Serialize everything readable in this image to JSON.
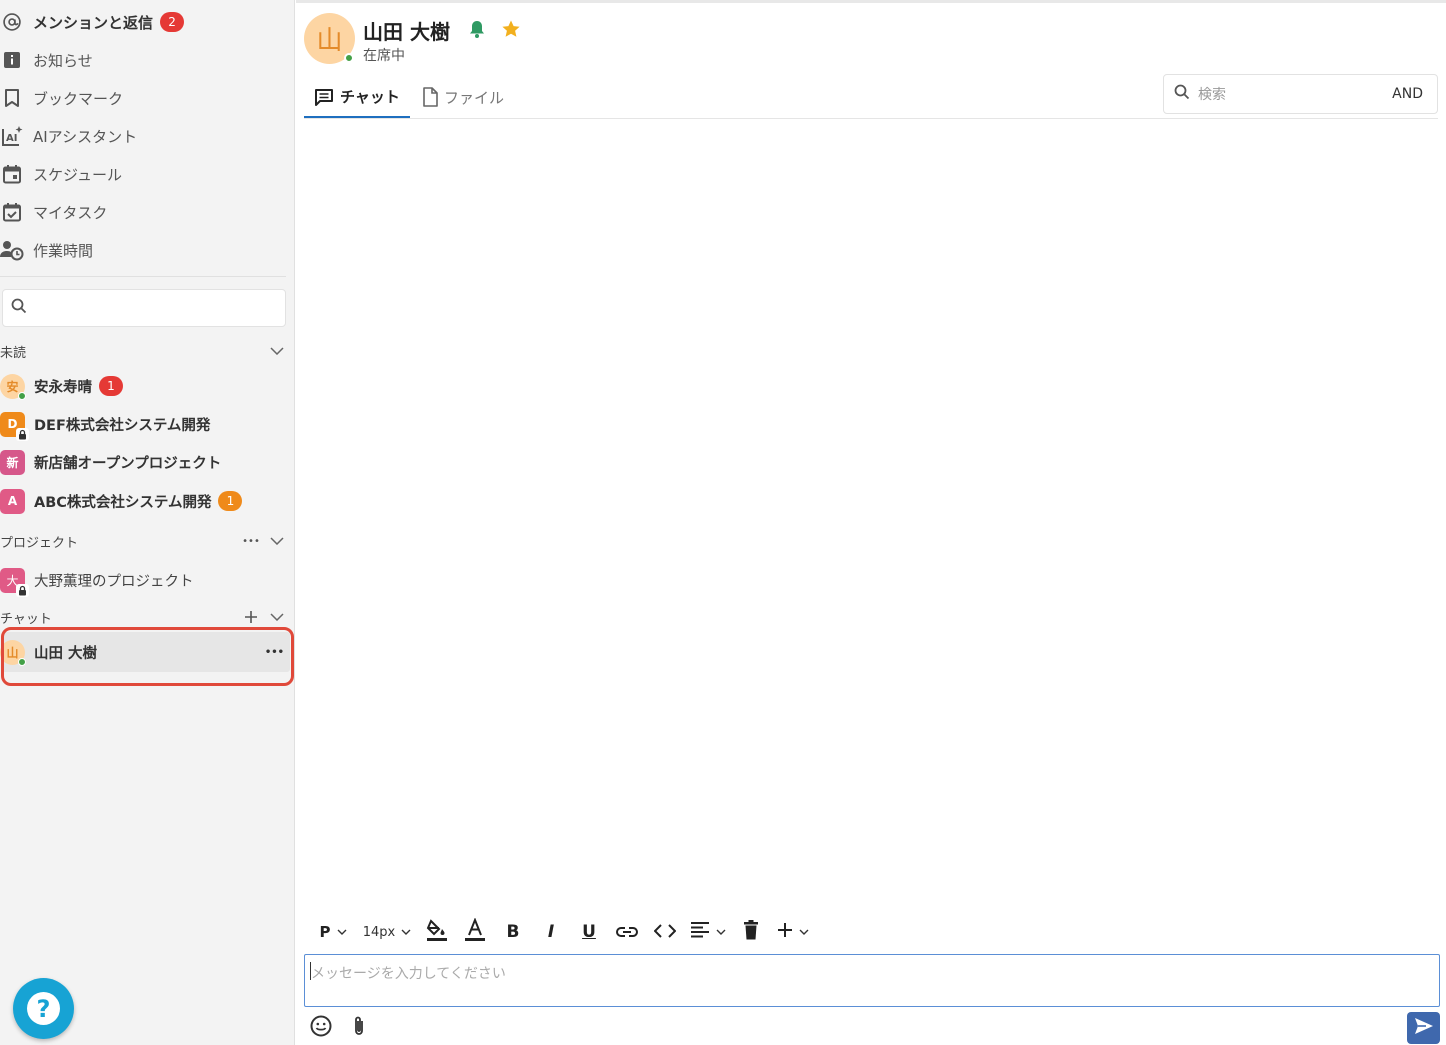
{
  "sidebar": {
    "nav": [
      {
        "label": "メンションと返信",
        "badge": "2",
        "icon": "at-icon"
      },
      {
        "label": "お知らせ",
        "icon": "info-icon"
      },
      {
        "label": "ブックマーク",
        "icon": "bookmark-icon"
      },
      {
        "label": "AIアシスタント",
        "icon": "ai-assistant-icon"
      },
      {
        "label": "スケジュール",
        "icon": "calendar-icon"
      },
      {
        "label": "マイタスク",
        "icon": "task-check-icon"
      },
      {
        "label": "作業時間",
        "icon": "user-clock-icon"
      }
    ],
    "search": {
      "placeholder": ""
    },
    "sections": {
      "unread": {
        "title": "未読",
        "items": [
          {
            "label": "安永寿晴",
            "avatar": "安",
            "badge": "1",
            "avatar_color": "#fdd5a3"
          },
          {
            "label": "DEF株式会社システム開発",
            "avatar": "D",
            "avatar_color": "#ef8a1a"
          },
          {
            "label": "新店舗オープンプロジェクト",
            "avatar": "新",
            "avatar_color": "#d6578a"
          },
          {
            "label": "ABC株式会社システム開発",
            "avatar": "A",
            "badge": "1",
            "avatar_color": "#e05a86"
          }
        ]
      },
      "projects": {
        "title": "プロジェクト",
        "more": "•••",
        "items": [
          {
            "label": "大野薫理のプロジェクト",
            "avatar": "大",
            "avatar_color": "#e05a86"
          }
        ]
      },
      "chat": {
        "title": "チャット",
        "items": [
          {
            "label": "山田 大樹",
            "avatar": "山",
            "more": "•••",
            "avatar_color": "#fdd5a3"
          }
        ]
      }
    },
    "help": "?"
  },
  "header": {
    "name": "山田 大樹",
    "avatar": "山",
    "status": "在席中"
  },
  "tabs": [
    {
      "label": "チャット",
      "active": true
    },
    {
      "label": "ファイル",
      "active": false
    }
  ],
  "message_search": {
    "placeholder": "検索",
    "mode": "AND"
  },
  "toolbar": {
    "paragraph": "P",
    "font_size": "14px",
    "bold": "B",
    "italic": "I",
    "underline": "U"
  },
  "composer": {
    "placeholder": "メッセージを入力してください"
  },
  "colors": {
    "accent": "#1e6fbf",
    "badge_red": "#e53935",
    "badge_orange": "#ef8a1a",
    "online": "#43a047",
    "highlight": "#e0493a",
    "send": "#3f68ad",
    "help": "#17a3d4"
  }
}
